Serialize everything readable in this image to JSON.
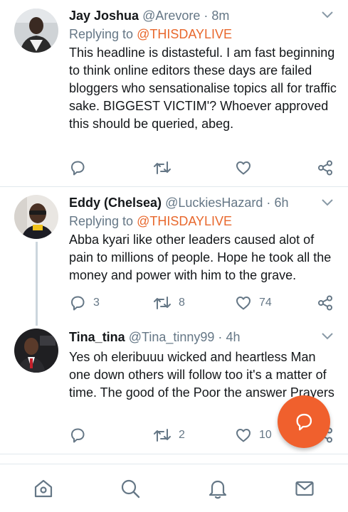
{
  "tweets": [
    {
      "name": "Jay Joshua",
      "handle": "@Arevore",
      "dot": "·",
      "time": "8m",
      "replying_prefix": "Replying to ",
      "replying_to": "@THISDAYLIVE",
      "text": "This headline is distasteful. I am fast beginning to think online editors these days are failed bloggers who sensationalise topics all for traffic sake. BIGGEST VICTIM'? Whoever approved this should be queried, abeg.",
      "replies": "",
      "retweets": "",
      "likes": ""
    },
    {
      "name": "Eddy (Chelsea)",
      "handle": "@LuckiesHazard",
      "dot": "·",
      "time": "6h",
      "replying_prefix": "Replying to ",
      "replying_to": "@THISDAYLIVE",
      "text": "Abba kyari like other leaders caused alot of pain to millions of people. Hope he took all the money and power with him to the grave.",
      "replies": "3",
      "retweets": "8",
      "likes": "74"
    },
    {
      "name": "Tina_tina",
      "handle": "@Tina_tinny99",
      "dot": "·",
      "time": "4h",
      "text": "Yes oh eleribuuu wicked and heartless Man one down others will follow too it's a matter of time. The good of the Poor the answer Prayers",
      "replies": "",
      "retweets": "2",
      "likes": "10"
    }
  ],
  "icons": {
    "reply": "reply-icon",
    "retweet": "retweet-icon",
    "like": "heart-icon",
    "share": "share-icon",
    "more": "chevron-down-icon",
    "compose": "compose-reply-icon",
    "nav": [
      "home-icon",
      "search-icon",
      "notifications-icon",
      "messages-icon"
    ]
  },
  "colors": {
    "accent": "#f0602d",
    "mention": "#e8682d",
    "secondary_text": "#657786",
    "divider": "#e1e8ed"
  }
}
